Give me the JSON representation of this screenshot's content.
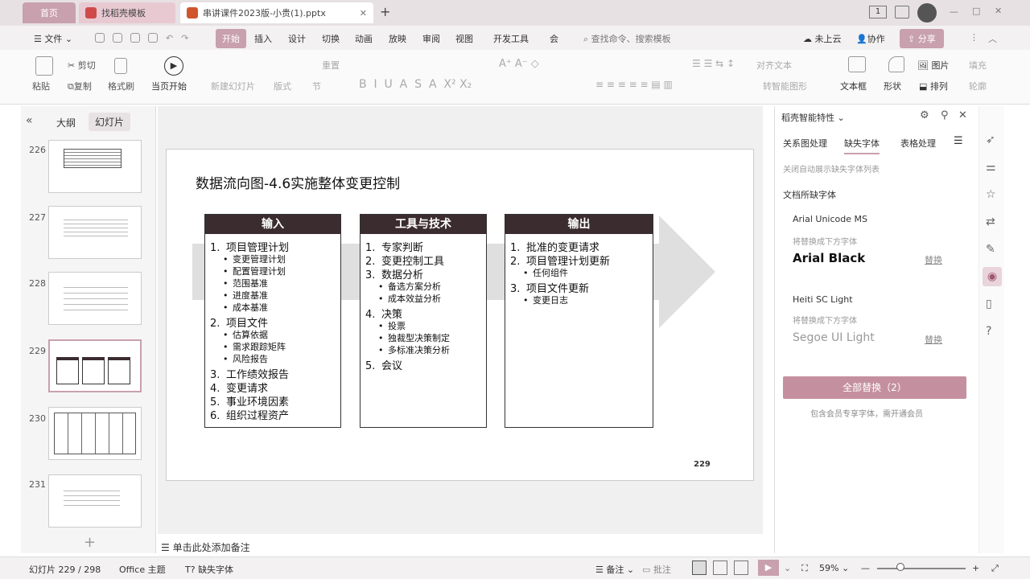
{
  "tabs": {
    "home": "首页",
    "template": "找稻壳模板",
    "document": "串讲课件2023版-小贵(1).pptx"
  },
  "window_badge": "1",
  "menu": {
    "file": "文件",
    "items": [
      "开始",
      "插入",
      "设计",
      "切换",
      "动画",
      "放映",
      "审阅",
      "视图",
      "开发工具",
      "会"
    ],
    "search": "查找命令、搜索模板",
    "cloud": "未上云",
    "collab": "协作",
    "share": "分享"
  },
  "ribbon": {
    "paste": "粘贴",
    "cut": "剪切",
    "copy": "复制",
    "format_painter": "格式刷",
    "play_current": "当页开始",
    "new_slide": "新建幻灯片",
    "layout": "版式",
    "section": "节",
    "reset": "重置",
    "align_text": "对齐文本",
    "textbox": "文本框",
    "shape": "形状",
    "picture": "图片",
    "arrange": "排列",
    "fill": "填充",
    "outline": "轮廓",
    "smartart": "转智能图形"
  },
  "left_pane": {
    "outline_tab": "大纲",
    "slides_tab": "幻灯片",
    "slides": [
      "226",
      "227",
      "228",
      "229",
      "230",
      "231"
    ],
    "add": "+"
  },
  "slide": {
    "title": "数据流向图-4.6实施整体变更控制",
    "page_number": "229",
    "inputs": {
      "header": "输入",
      "items": [
        {
          "n": "1.",
          "text": "项目管理计划"
        },
        {
          "n": "•",
          "text": "变更管理计划",
          "sub": true
        },
        {
          "n": "•",
          "text": "配置管理计划",
          "sub": true
        },
        {
          "n": "•",
          "text": "范围基准",
          "sub": true
        },
        {
          "n": "•",
          "text": "进度基准",
          "sub": true
        },
        {
          "n": "•",
          "text": "成本基准",
          "sub": true
        },
        {
          "n": "2.",
          "text": "项目文件"
        },
        {
          "n": "•",
          "text": "估算依据",
          "sub": true
        },
        {
          "n": "•",
          "text": "需求跟踪矩阵",
          "sub": true
        },
        {
          "n": "•",
          "text": "风险报告",
          "sub": true
        },
        {
          "n": "3.",
          "text": "工作绩效报告"
        },
        {
          "n": "4.",
          "text": "变更请求"
        },
        {
          "n": "5.",
          "text": "事业环境因素"
        },
        {
          "n": "6.",
          "text": "组织过程资产"
        }
      ]
    },
    "tools": {
      "header": "工具与技术",
      "items": [
        {
          "n": "1.",
          "text": "专家判断"
        },
        {
          "n": "2.",
          "text": "变更控制工具"
        },
        {
          "n": "3.",
          "text": "数据分析"
        },
        {
          "n": "•",
          "text": "备选方案分析",
          "sub": true
        },
        {
          "n": "•",
          "text": "成本效益分析",
          "sub": true
        },
        {
          "n": "4.",
          "text": "决策"
        },
        {
          "n": "•",
          "text": "投票",
          "sub": true
        },
        {
          "n": "•",
          "text": "独裁型决策制定",
          "sub": true
        },
        {
          "n": "•",
          "text": "多标准决策分析",
          "sub": true
        },
        {
          "n": "5.",
          "text": "会议"
        }
      ]
    },
    "outputs": {
      "header": "输出",
      "items": [
        {
          "n": "1.",
          "text": "批准的变更请求"
        },
        {
          "n": "2.",
          "text": "项目管理计划更新"
        },
        {
          "n": "•",
          "text": "任何组件",
          "sub": true
        },
        {
          "n": "3.",
          "text": "项目文件更新"
        },
        {
          "n": "•",
          "text": "变更日志",
          "sub": true
        }
      ]
    }
  },
  "notes_placeholder": "单击此处添加备注",
  "right_pane": {
    "title": "稻壳智能特性",
    "tabs": [
      "关系图处理",
      "缺失字体",
      "表格处理"
    ],
    "hint": "关闭自动展示缺失字体列表",
    "section": "文档所缺字体",
    "fonts": [
      {
        "missing": "Arial Unicode MS",
        "replace_label": "将替换成下方字体",
        "replacement": "Arial Black",
        "action": "替换"
      },
      {
        "missing": "Heiti SC Light",
        "replace_label": "将替换成下方字体",
        "replacement": "Segoe UI Light",
        "action": "替换"
      }
    ],
    "replace_all": "全部替换（2）",
    "note": "包含会员专享字体，需开通会员"
  },
  "status": {
    "slide_info": "幻灯片 229 / 298",
    "theme": "Office 主题",
    "missing_font": "缺失字体",
    "notes": "备注",
    "comment": "批注",
    "zoom": "59%"
  },
  "colors": {
    "accent": "#c9a0ad",
    "header_dark": "#3b2c30",
    "arrow": "#d9d9d9"
  }
}
